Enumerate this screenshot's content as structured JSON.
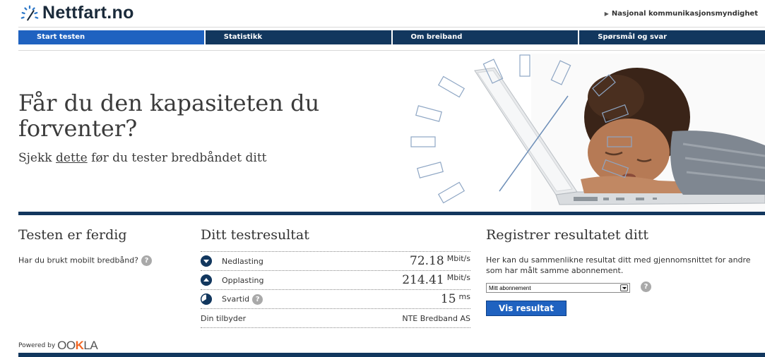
{
  "header": {
    "site_name": "Nettfart.no",
    "top_link": "Nasjonal kommunikasjonsmyndighet"
  },
  "nav": {
    "items": [
      {
        "label": "Start testen",
        "active": true
      },
      {
        "label": "Statistikk",
        "active": false
      },
      {
        "label": "Om breiband",
        "active": false
      },
      {
        "label": "Spørsmål og svar",
        "active": false
      }
    ]
  },
  "hero": {
    "title": "Får du den kapasiteten du forventer?",
    "subtitle_prefix": "Sjekk",
    "subtitle_link": "dette",
    "subtitle_suffix": "før du tester bredbåndet ditt"
  },
  "test_done": {
    "title": "Testen er ferdig",
    "mobile_question": "Har du brukt mobilt bredbånd?"
  },
  "results": {
    "title": "Ditt testresultat",
    "rows": [
      {
        "label": "Nedlasting",
        "value": "72.18",
        "unit": "Mbit/s",
        "icon": "download-icon"
      },
      {
        "label": "Opplasting",
        "value": "214.41",
        "unit": "Mbit/s",
        "icon": "upload-icon"
      },
      {
        "label": "Svartid",
        "value": "15",
        "unit": "ms",
        "icon": "clock-icon"
      }
    ],
    "provider_label": "Din tilbyder",
    "provider_value": "NTE Bredband AS"
  },
  "register": {
    "title": "Registrer resultatet ditt",
    "text": "Her kan du sammenlikne resultat ditt med gjennomsnittet for andre som har målt samme abonnement.",
    "select_value": "Mitt abonnement",
    "button_label": "Vis resultat"
  },
  "footer": {
    "powered_by": "Powered by",
    "brand": "OOKLA"
  },
  "colors": {
    "navy": "#12375e",
    "active_blue": "#1f62c0",
    "accent_orange": "#f26522"
  }
}
